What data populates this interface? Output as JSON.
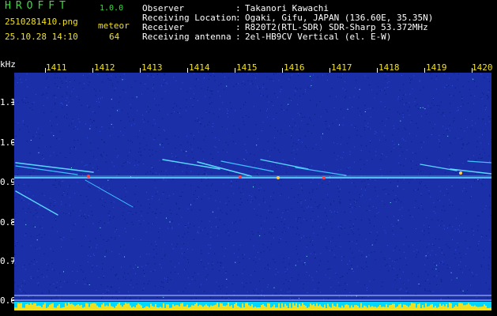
{
  "header": {
    "logo": "HROFFT",
    "version": "1.0.0",
    "filename": "2510281410.png",
    "category_label": "meteor",
    "datetime": "25.10.28 14:10",
    "count_value": "64"
  },
  "station": {
    "observer_label": "Observer",
    "observer_value": "Takanori Kawachi",
    "location_label": "Receiving Location",
    "location_value": "Ogaki, Gifu, JAPAN (136.60E, 35.35N)",
    "receiver_label": "Receiver",
    "receiver_value": "R820T2(RTL-SDR) SDR-Sharp 53.372MHz",
    "antenna_label": "Receiving antenna",
    "antenna_value": "2el-HB9CV Vertical (el. E-W)",
    "separator": ":"
  },
  "spectrogram": {
    "y_unit": "kHz",
    "y_ticks": [
      "1.1",
      "1.0",
      "0.9",
      "0.8",
      "0.7",
      "0.6"
    ],
    "x_ticks": [
      "1411",
      "1412",
      "1413",
      "1414",
      "1415",
      "1416",
      "1417",
      "1418",
      "1419",
      "1420"
    ],
    "colors": {
      "background": "#1a2fa8",
      "noise": "#3050e0",
      "trace": "#5ad8ff",
      "hot": "#ff4040",
      "floor": "#00d8ff",
      "floor_peak": "#f0e020"
    }
  }
}
